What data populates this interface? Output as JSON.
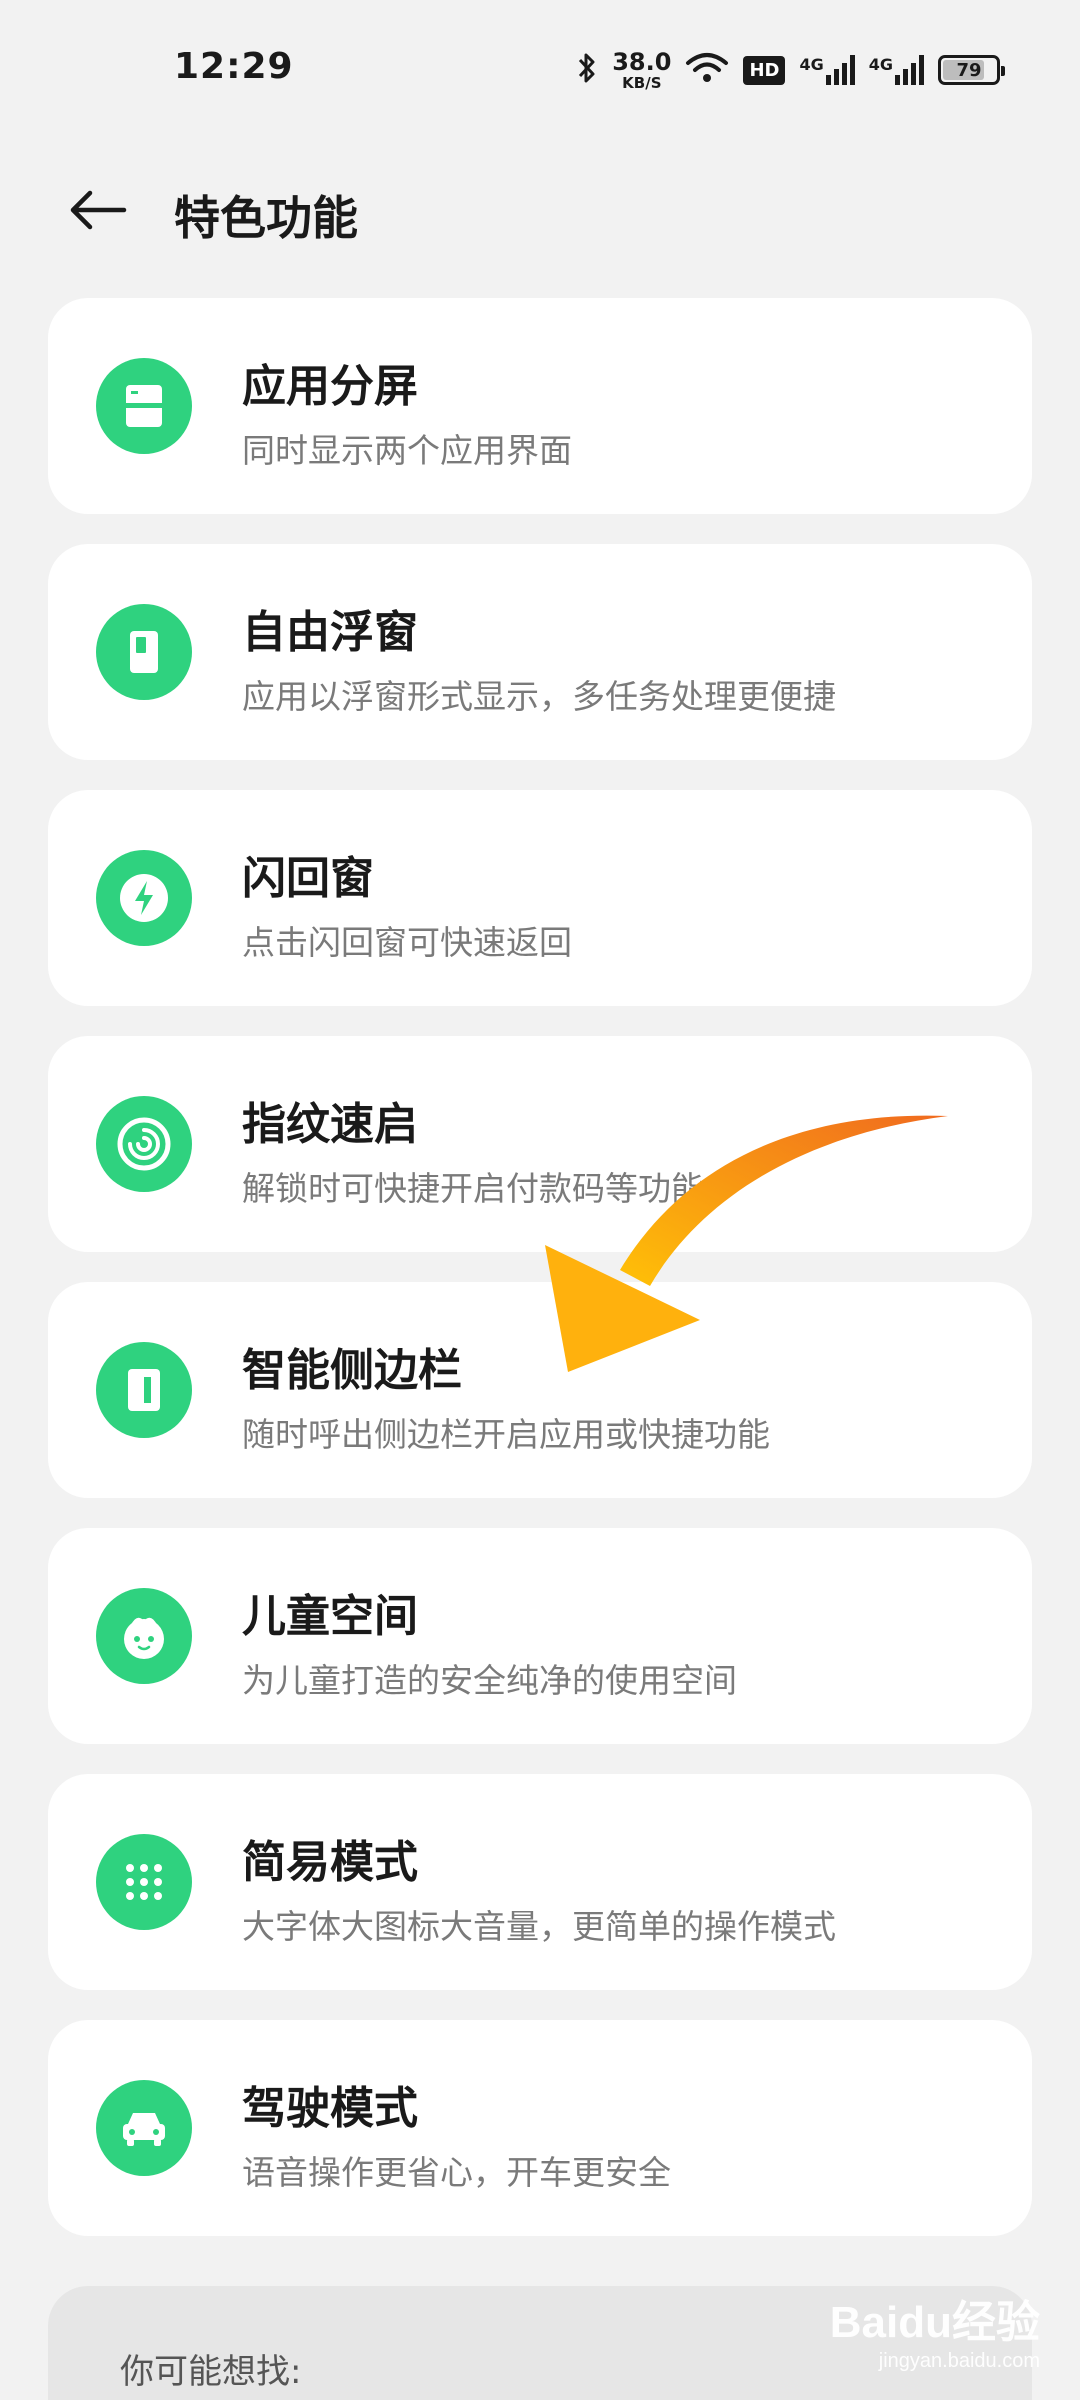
{
  "status_bar": {
    "time": "12:29",
    "net_speed_value": "38.0",
    "net_speed_unit": "KB/S",
    "hd_badge": "HD",
    "sim1_tag": "4G",
    "sim2_tag": "4G",
    "battery_level": "79",
    "battery_fraction": 0.79
  },
  "header": {
    "title": "特色功能"
  },
  "features": [
    {
      "title": "应用分屏",
      "desc": "同时显示两个应用界面",
      "icon": "split-screen-icon"
    },
    {
      "title": "自由浮窗",
      "desc": "应用以浮窗形式显示，多任务处理更便捷",
      "icon": "floating-window-icon"
    },
    {
      "title": "闪回窗",
      "desc": "点击闪回窗可快速返回",
      "icon": "flash-bolt-icon"
    },
    {
      "title": "指纹速启",
      "desc": "解锁时可快捷开启付款码等功能",
      "icon": "fingerprint-icon"
    },
    {
      "title": "智能侧边栏",
      "desc": "随时呼出侧边栏开启应用或快捷功能",
      "icon": "sidebar-icon"
    },
    {
      "title": "儿童空间",
      "desc": "为儿童打造的安全纯净的使用空间",
      "icon": "kid-face-icon"
    },
    {
      "title": "简易模式",
      "desc": "大字体大图标大音量，更简单的操作模式",
      "icon": "grid-dots-icon"
    },
    {
      "title": "驾驶模式",
      "desc": "语音操作更省心，开车更安全",
      "icon": "car-icon"
    }
  ],
  "suggestion": {
    "label": "你可能想找:"
  },
  "watermark": {
    "logo": "Baidu经验",
    "url": "jingyan.baidu.com"
  },
  "colors": {
    "accent": "#2fd27f",
    "card_bg": "#ffffff",
    "page_bg": "#f2f2f2",
    "arrow_start": "#ffc107",
    "arrow_end": "#f06a1f"
  }
}
